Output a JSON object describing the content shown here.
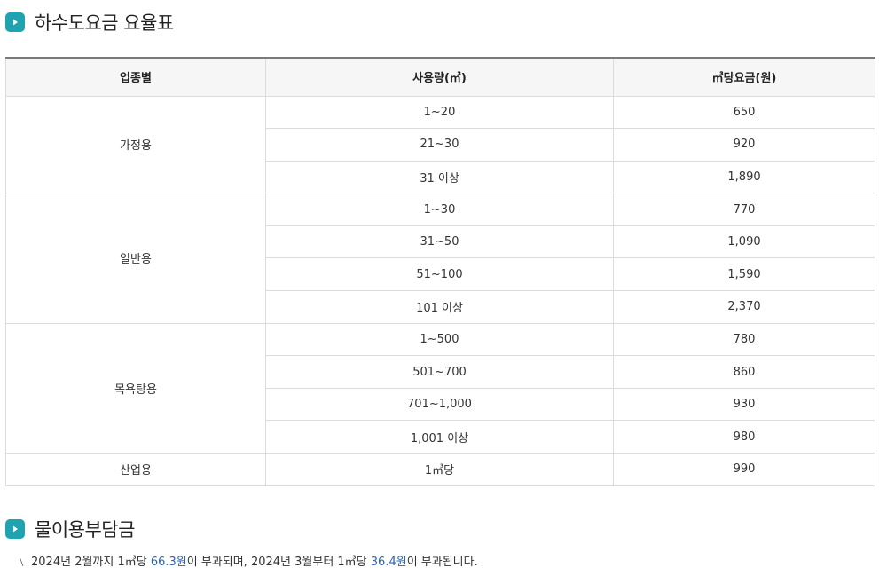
{
  "section1": {
    "title": "하수도요금 요율표"
  },
  "table": {
    "headers": [
      "업종별",
      "사용량(㎥)",
      "㎥당요금(원)"
    ],
    "groups": [
      {
        "category": "가정용",
        "rows": [
          {
            "usage": "1~20",
            "rate": "650"
          },
          {
            "usage": "21~30",
            "rate": "920"
          },
          {
            "usage": "31 이상",
            "rate": "1,890"
          }
        ]
      },
      {
        "category": "일반용",
        "rows": [
          {
            "usage": "1~30",
            "rate": "770"
          },
          {
            "usage": "31~50",
            "rate": "1,090"
          },
          {
            "usage": "51~100",
            "rate": "1,590"
          },
          {
            "usage": "101 이상",
            "rate": "2,370"
          }
        ]
      },
      {
        "category": "목욕탕용",
        "rows": [
          {
            "usage": "1~500",
            "rate": "780"
          },
          {
            "usage": "501~700",
            "rate": "860"
          },
          {
            "usage": "701~1,000",
            "rate": "930"
          },
          {
            "usage": "1,001 이상",
            "rate": "980"
          }
        ]
      },
      {
        "category": "산업용",
        "rows": [
          {
            "usage": "1㎥당",
            "rate": "990"
          }
        ]
      }
    ]
  },
  "section2": {
    "title": "물이용부담금"
  },
  "note": {
    "mark": "﹨",
    "part1": "2024년 2월까지 1㎥당 ",
    "value1": "66.3원",
    "part2": "이 부과되며, 2024년 3월부터 1㎥당 ",
    "value2": "36.4원",
    "part3": "이 부과됩니다."
  },
  "colors": {
    "accent": "#1fa3b0",
    "highlight": "#2a63b8",
    "header_bg": "#f6f6f6"
  },
  "icons": {
    "section_badge": "play-triangle-icon"
  }
}
